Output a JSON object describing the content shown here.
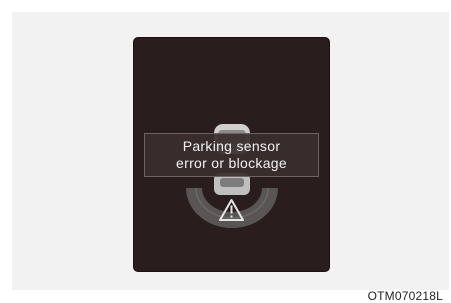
{
  "display": {
    "message": {
      "line1": "Parking sensor",
      "line2": "error or blockage"
    },
    "warning_icon": "warning-triangle-icon",
    "colors": {
      "screen_background": "#2a1d1d",
      "warning_arc": "#5a5555",
      "car_body": "#cfcfcf",
      "text": "#f2f2f2"
    }
  },
  "figure_code": "OTM070218L"
}
